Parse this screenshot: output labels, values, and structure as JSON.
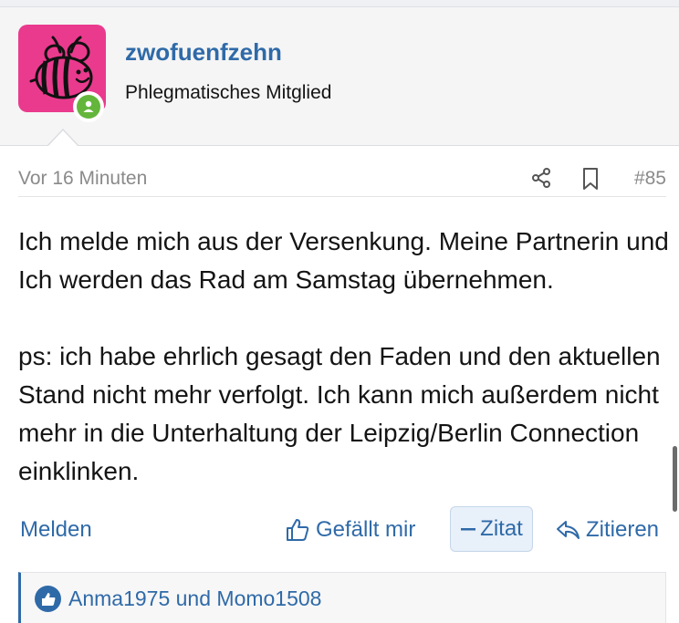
{
  "user": {
    "name": "zwofuenfzehn",
    "title": "Phlegmatisches Mitglied",
    "online": true
  },
  "post": {
    "time": "Vor 16 Minuten",
    "number": "#85",
    "paragraphs": [
      "Ich melde mich aus der Versenkung. Meine Partnerin und Ich werden das Rad am Samstag übernehmen.",
      "ps: ich habe ehrlich gesagt den Faden und den aktuellen Stand nicht mehr verfolgt. Ich kann mich außerdem nicht mehr in die Unterhaltung der Leipzig/Berlin Connection einklinken."
    ]
  },
  "actions": {
    "report": "Melden",
    "like": "Gefällt mir",
    "quote": "Zitat",
    "reply": "Zitieren"
  },
  "reactions": {
    "users": "Anma1975 und Momo1508"
  },
  "colors": {
    "accent": "#2f6aa8",
    "avatar_bg": "#ea3a8d",
    "online": "#63b63b"
  }
}
